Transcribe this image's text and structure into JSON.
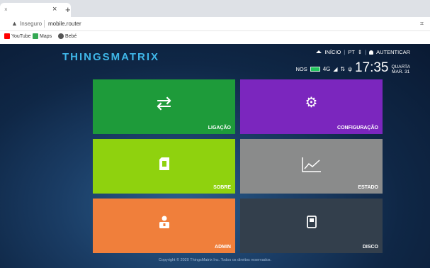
{
  "browser": {
    "tab_favicon": "×",
    "tab_close": "×",
    "new_tab": "+",
    "insecure_label": "Inseguro",
    "url": "mobile.router",
    "bookmarks": [
      {
        "label": "YouTube",
        "color": "#ff0000"
      },
      {
        "label": "Maps",
        "color": "#34a853"
      },
      {
        "label": "Bebé",
        "color": "#555555"
      }
    ]
  },
  "header": {
    "logo": "THINGSMATRIX",
    "nav_home": "INÍCIO",
    "nav_lang": "PT",
    "nav_auth": "AUTENTICAR",
    "operator": "NOS",
    "network": "4G",
    "time": "17:35",
    "weekday": "QUARTA",
    "date": "MAR. 31"
  },
  "tiles": [
    {
      "label": "LIGAÇÃO",
      "icon": "⇄",
      "color": "#1e9b3a"
    },
    {
      "label": "CONFIGURAÇÃO",
      "icon": "⚙",
      "color": "#7b26be"
    },
    {
      "label": "SOBRE",
      "icon": "▮",
      "color": "#8fd20e"
    },
    {
      "label": "ESTADO",
      "icon": "chart-line-icon",
      "color": "#8a8b8b"
    },
    {
      "label": "ADMIN",
      "icon": "admin-user-icon",
      "color": "#f07f3b"
    },
    {
      "label": "DISCO",
      "icon": "disk-card-icon",
      "color": "#333f4c"
    }
  ],
  "footer": "Copyright © 2020 ThingsMatrix Inc. Todos os direitos reservados."
}
